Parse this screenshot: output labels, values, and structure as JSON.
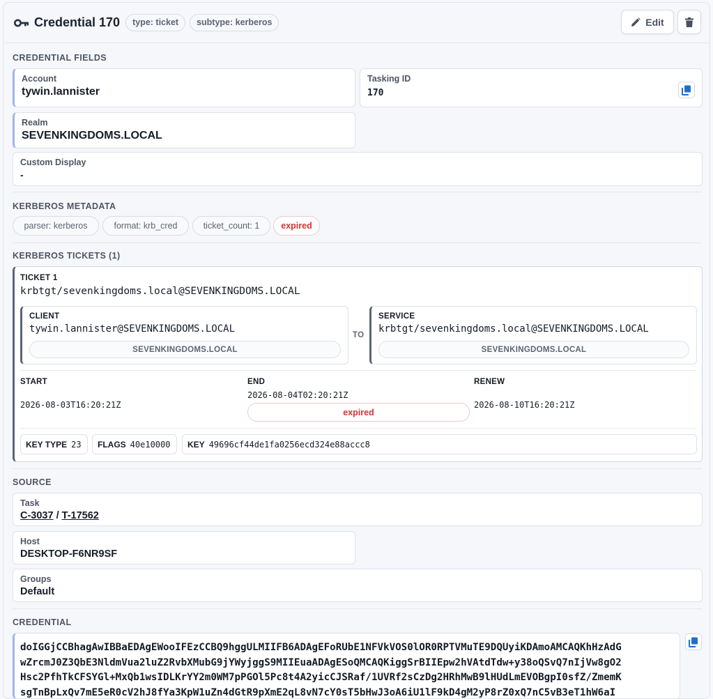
{
  "header": {
    "title": "Credential 170",
    "chips": [
      "type: ticket",
      "subtype: kerberos"
    ],
    "edit_label": "Edit"
  },
  "credential_fields": {
    "section_title": "CREDENTIAL FIELDS",
    "account_label": "Account",
    "account_value": "tywin.lannister",
    "tasking_label": "Tasking ID",
    "tasking_value": "170",
    "realm_label": "Realm",
    "realm_value": "SEVENKINGDOMS.LOCAL",
    "custom_label": "Custom Display",
    "custom_value": "-"
  },
  "kerberos_metadata": {
    "section_title": "KERBEROS METADATA",
    "chips": [
      "parser: kerberos",
      "format: krb_cred",
      "ticket_count: 1",
      "expired"
    ]
  },
  "kerberos_tickets": {
    "section_title": "KERBEROS TICKETS (1)",
    "ticket": {
      "label": "TICKET 1",
      "spn": "krbtgt/sevenkingdoms.local@SEVENKINGDOMS.LOCAL",
      "client_label": "CLIENT",
      "client_value": "tywin.lannister@SEVENKINGDOMS.LOCAL",
      "client_realm": "SEVENKINGDOMS.LOCAL",
      "to_label": "TO",
      "service_label": "SERVICE",
      "service_value": "krbtgt/sevenkingdoms.local@SEVENKINGDOMS.LOCAL",
      "service_realm": "SEVENKINGDOMS.LOCAL",
      "start_label": "START",
      "start_value": "2026-08-03T16:20:21Z",
      "end_label": "END",
      "end_value": "2026-08-04T02:20:21Z",
      "end_status": "expired",
      "renew_label": "RENEW",
      "renew_value": "2026-08-10T16:20:21Z",
      "key_type_label": "KEY TYPE",
      "key_type_value": "23",
      "flags_label": "FLAGS",
      "flags_value": "40e10000",
      "key_label": "KEY",
      "key_value": "49696cf44de1fa0256ecd324e88accc8"
    }
  },
  "source": {
    "section_title": "SOURCE",
    "task_label": "Task",
    "task_callback": "C-3037",
    "task_sep": " / ",
    "task_id": "T-17562",
    "host_label": "Host",
    "host_value": "DESKTOP-F6NR9SF",
    "groups_label": "Groups",
    "groups_value": "Default"
  },
  "credential": {
    "section_title": "CREDENTIAL",
    "lines": [
      "doIGGjCCBhagAwIBBaEDAgEWooIFEzCCBQ9hggULMIIFB6ADAgEFoRUbE1NFVkVOS0lOR0RPTVMuTE9DQUyiKDAmoAMCAQKhHzAdG",
      "wZrcmJ0Z3QbE3NldmVua2luZ2RvbXMubG9jYWyjggS9MIIEuaADAgESoQMCAQKiggSrBIIEpw2hVAtdTdw+y38oQSvQ7nIjVw8gO2",
      "Hsc2PfhTkCFSYGl+MxQb1wsIDLKrYY2m0WM7pPGOl5Pc8t4A2yicCJSRaf/1UVRf2sCzDg2HRhMwB9lHUdLmEVOBgpI0sfZ/ZmemK",
      "sgTnBpLxQv7mE5eR0cV2hJ8fYa3KpW1uZn4dGtR9pXmE2qL8vN7cY0sT5bHwJ3oA6iU1lF9kD4gM2yP8rZ0xQ7nC5vB3eT1hW6aI"
    ]
  },
  "colors": {
    "accent_blue": "#9fb6e6",
    "ticket_border": "#5a6478",
    "expired_red": "#d43333",
    "copy_blue": "#1f6fd1"
  }
}
